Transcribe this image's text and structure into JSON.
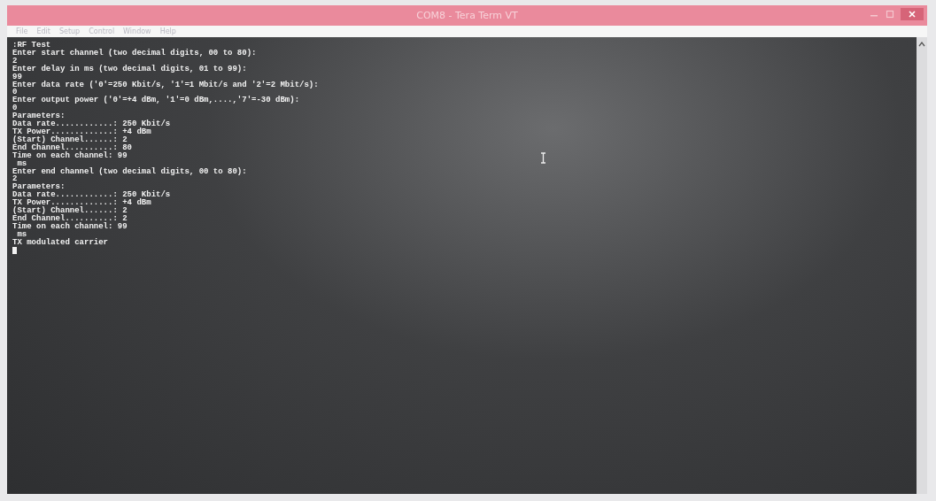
{
  "window": {
    "title": "COM8 - Tera Term VT"
  },
  "menu": [
    "File",
    "Edit",
    "Setup",
    "Control",
    "Window",
    "Help"
  ],
  "terminal": {
    "lines": [
      ":RF Test",
      "Enter start channel (two decimal digits, 00 to 80):",
      "2",
      "Enter delay in ms (two decimal digits, 01 to 99):",
      "99",
      "Enter data rate ('0'=250 Kbit/s, '1'=1 Mbit/s and '2'=2 Mbit/s):",
      "0",
      "Enter output power ('0'=+4 dBm, '1'=0 dBm,....,'7'=-30 dBm):",
      "0",
      "Parameters:",
      "Data rate............: 250 Kbit/s",
      "TX Power.............: +4 dBm",
      "(Start) Channel......: 2",
      "End Channel..........: 80",
      "Time on each channel: 99",
      " ms",
      "Enter end channel (two decimal digits, 00 to 80):",
      "2",
      "Parameters:",
      "Data rate............: 250 Kbit/s",
      "TX Power.............: +4 dBm",
      "(Start) Channel......: 2",
      "End Channel..........: 2",
      "Time on each channel: 99",
      " ms",
      "TX modulated carrier"
    ]
  }
}
